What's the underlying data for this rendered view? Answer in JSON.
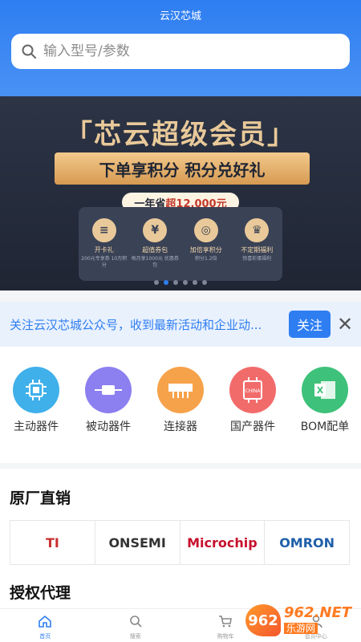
{
  "app": {
    "title": "云汉芯城"
  },
  "search": {
    "placeholder": "输入型号/参数"
  },
  "banner": {
    "title": "「芯云超级会员」",
    "ribbon": "下单享积分 积分兑好礼",
    "pill_prefix": "一年省",
    "pill_highlight": "超12,000元",
    "benefits": [
      {
        "icon": "card-icon",
        "glyph": "≡",
        "title": "开卡礼",
        "desc": "200元专享券 10万积分"
      },
      {
        "icon": "ticket-icon",
        "glyph": "¥",
        "title": "超值券包",
        "desc": "每月享1000元 优惠券包"
      },
      {
        "icon": "coins-icon",
        "glyph": "◎",
        "title": "加倍享积分",
        "desc": "积分1.2倍"
      },
      {
        "icon": "crown-icon",
        "glyph": "♛",
        "title": "不定期福利",
        "desc": "惊喜彩蛋福利"
      }
    ],
    "dots_count": 6,
    "active_dot": 1
  },
  "notice": {
    "text": "关注云汉芯城公众号，收到最新活动和企业动...",
    "follow_label": "关注",
    "close_glyph": "✕"
  },
  "categories": [
    {
      "label": "主动器件",
      "color": "#3fb0ea",
      "icon": "chip-icon"
    },
    {
      "label": "被动器件",
      "color": "#8c7ff0",
      "icon": "resistor-icon"
    },
    {
      "label": "连接器",
      "color": "#f6a24a",
      "icon": "connector-icon"
    },
    {
      "label": "国产器件",
      "color": "#f26b6b",
      "icon": "china-chip-icon"
    },
    {
      "label": "BOM配单",
      "color": "#3ec17a",
      "icon": "excel-icon"
    }
  ],
  "direct_sales": {
    "title": "原厂直销",
    "brands": [
      {
        "name": "TI",
        "color": "#c8302f"
      },
      {
        "name": "ONSEMI",
        "color": "#333333"
      },
      {
        "name": "Microchip",
        "color": "#c8102e"
      },
      {
        "name": "OMRON",
        "color": "#1f5fa8"
      }
    ]
  },
  "agents": {
    "title": "授权代理"
  },
  "tabbar": [
    {
      "label": "首页",
      "icon": "home-icon",
      "active": true
    },
    {
      "label": "搜索",
      "icon": "search-icon",
      "active": false
    },
    {
      "label": "购物车",
      "icon": "cart-icon",
      "active": false
    },
    {
      "label": "会员中心",
      "icon": "user-icon",
      "active": false
    }
  ],
  "watermark": {
    "badge": "962",
    "domain": "962.NET",
    "site": "乐游网"
  },
  "colors": {
    "primary": "#2e7ef2",
    "gold": "#e9c99a"
  }
}
